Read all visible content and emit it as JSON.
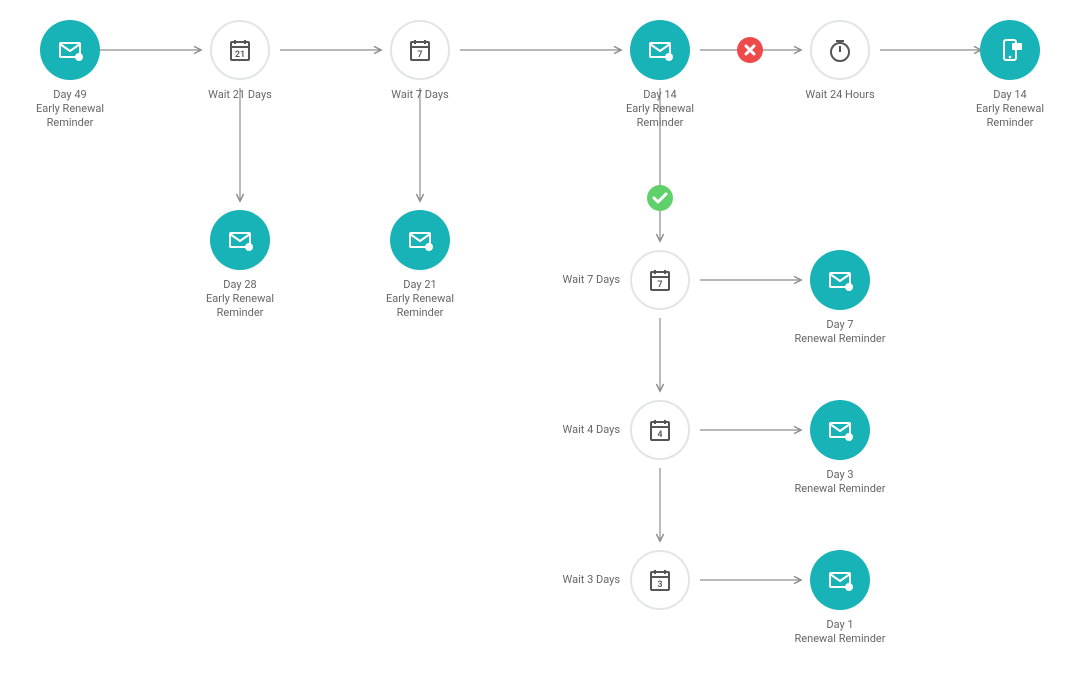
{
  "colors": {
    "teal": "#17b3b6",
    "gray": "#8d8d8d",
    "red": "#ef4a4a",
    "green": "#5fd06a"
  },
  "nodes": {
    "n1": {
      "l1": "Day 49",
      "l2": "Early Renewal",
      "l3": "Reminder"
    },
    "n2": {
      "l1": "Wait 21 Days",
      "cal": "21"
    },
    "n3": {
      "l1": "Wait 7 Days",
      "cal": "7"
    },
    "n4": {
      "l1": "Day 14",
      "l2": "Early Renewal",
      "l3": "Reminder"
    },
    "n5": {
      "l1": "Wait 24 Hours"
    },
    "n6": {
      "l1": "Day 14",
      "l2": "Early Renewal",
      "l3": "Reminder"
    },
    "n7": {
      "l1": "Day 28",
      "l2": "Early Renewal",
      "l3": "Reminder"
    },
    "n8": {
      "l1": "Day 21",
      "l2": "Early Renewal",
      "l3": "Reminder"
    },
    "n9": {
      "side": "Wait 7 Days",
      "cal": "7"
    },
    "n10": {
      "l1": "Day 7",
      "l2": "Renewal Reminder"
    },
    "n11": {
      "side": "Wait 4 Days",
      "cal": "4"
    },
    "n12": {
      "l1": "Day 3",
      "l2": "Renewal Reminder"
    },
    "n13": {
      "side": "Wait 3 Days",
      "cal": "3"
    },
    "n14": {
      "l1": "Day 1",
      "l2": "Renewal Reminder"
    }
  }
}
